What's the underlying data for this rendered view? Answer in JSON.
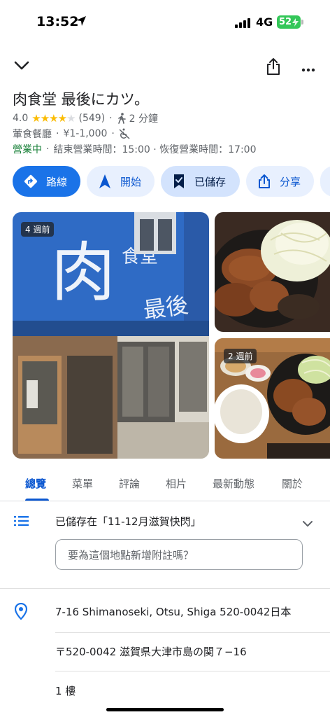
{
  "status_bar": {
    "time": "13:52",
    "network": "4G",
    "battery": "52",
    "location_icon": "location-arrow-icon",
    "signal_icon": "signal-bars-icon"
  },
  "header": {
    "collapse_icon": "chevron-down-icon",
    "share_icon": "share-icon",
    "more_icon": "more-horizontal-icon"
  },
  "place": {
    "name": "肉食堂 最後にカツ。",
    "rating": "4.0",
    "rating_stars": 4,
    "review_count": "(549)",
    "walk_time": "2 分鐘",
    "category": "葷食餐廳",
    "price": "¥1-1,000",
    "open_status": "營業中",
    "hours_info": "結束營業時間：15:00 · 恢復營業時間：17:00"
  },
  "actions": {
    "directions": "路線",
    "start": "開始",
    "saved": "已儲存",
    "share": "分享"
  },
  "photos": {
    "main_badge": "4 週前",
    "side_badge": "2 週前"
  },
  "tabs": [
    "總覽",
    "菜單",
    "評論",
    "相片",
    "最新動態",
    "關於"
  ],
  "active_tab": 0,
  "saved_list": {
    "label": "已儲存在「11-12月滋賀快閃」"
  },
  "note_input": {
    "placeholder": "要為這個地點新增附註嗎？"
  },
  "address": {
    "line_en": "7-16 Shimanoseki, Otsu, Shiga 520-0042日本",
    "line_jp": "〒520-0042 滋賀県大津市島の関７−16",
    "floor": "1 樓"
  },
  "colors": {
    "accent": "#1a73e8",
    "open_green": "#188038",
    "star": "#fbbc04",
    "chip_bg": "#e8f0fe"
  }
}
